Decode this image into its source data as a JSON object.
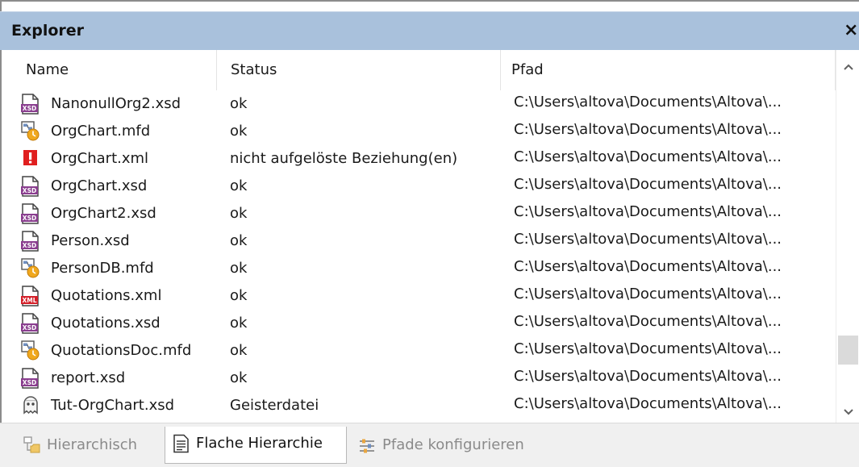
{
  "panel": {
    "title": "Explorer",
    "close_label": "×"
  },
  "columns": {
    "name": "Name",
    "status": "Status",
    "path": "Pfad"
  },
  "rows": [
    {
      "name": "NanonullOrg2.xsd",
      "status": "ok",
      "path": "C:\\Users\\altova\\Documents\\Altova\\...",
      "icon": "xsd-file-icon"
    },
    {
      "name": "OrgChart.mfd",
      "status": "ok",
      "path": "C:\\Users\\altova\\Documents\\Altova\\...",
      "icon": "mfd-file-icon"
    },
    {
      "name": "OrgChart.xml",
      "status": "nicht aufgelöste Beziehung(en)",
      "path": "C:\\Users\\altova\\Documents\\Altova\\...",
      "icon": "error-icon"
    },
    {
      "name": "OrgChart.xsd",
      "status": "ok",
      "path": "C:\\Users\\altova\\Documents\\Altova\\...",
      "icon": "xsd-file-icon"
    },
    {
      "name": "OrgChart2.xsd",
      "status": "ok",
      "path": "C:\\Users\\altova\\Documents\\Altova\\...",
      "icon": "xsd-file-icon"
    },
    {
      "name": "Person.xsd",
      "status": "ok",
      "path": "C:\\Users\\altova\\Documents\\Altova\\...",
      "icon": "xsd-file-icon"
    },
    {
      "name": "PersonDB.mfd",
      "status": "ok",
      "path": "C:\\Users\\altova\\Documents\\Altova\\...",
      "icon": "mfd-file-icon"
    },
    {
      "name": "Quotations.xml",
      "status": "ok",
      "path": "C:\\Users\\altova\\Documents\\Altova\\...",
      "icon": "xml-file-icon"
    },
    {
      "name": "Quotations.xsd",
      "status": "ok",
      "path": "C:\\Users\\altova\\Documents\\Altova\\...",
      "icon": "xsd-file-icon"
    },
    {
      "name": "QuotationsDoc.mfd",
      "status": "ok",
      "path": "C:\\Users\\altova\\Documents\\Altova\\...",
      "icon": "mfd-file-icon"
    },
    {
      "name": "report.xsd",
      "status": "ok",
      "path": "C:\\Users\\altova\\Documents\\Altova\\...",
      "icon": "xsd-file-icon"
    },
    {
      "name": "Tut-OrgChart.xsd",
      "status": "Geisterdatei",
      "path": "C:\\Users\\altova\\Documents\\Altova\\...",
      "icon": "ghost-file-icon"
    }
  ],
  "tabs": [
    {
      "label": "Hierarchisch",
      "icon": "hierarchy-icon",
      "active": false
    },
    {
      "label": "Flache Hierarchie",
      "icon": "flat-list-icon",
      "active": true
    },
    {
      "label": "Pfade konfigurieren",
      "icon": "configure-paths-icon",
      "active": false
    }
  ],
  "colors": {
    "title_bar": "#a9c1dc",
    "tab_bar": "#f0f0f0",
    "error": "#e01f1f",
    "xsd_badge": "#8a3e8f"
  }
}
